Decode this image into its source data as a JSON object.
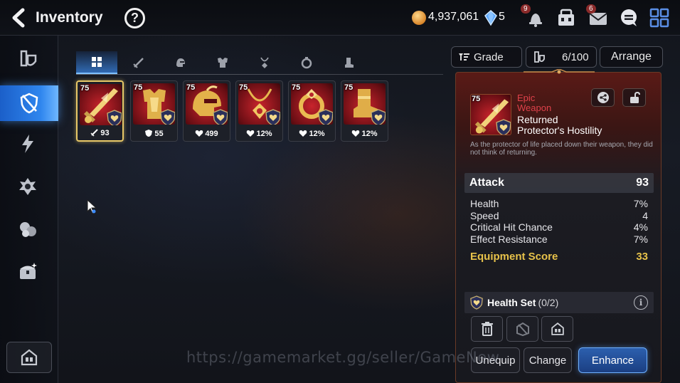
{
  "header": {
    "title": "Inventory",
    "help_label": "?",
    "gold": "4,937,061",
    "skystones": "5",
    "notif_badge_bell": "9",
    "notif_badge_mail": "6"
  },
  "sidebar": {
    "items": [
      {
        "name": "equipment-category-icon"
      },
      {
        "name": "gear-category-icon",
        "active": true
      },
      {
        "name": "lightning-category-icon"
      },
      {
        "name": "artifact-category-icon"
      },
      {
        "name": "material-category-icon"
      },
      {
        "name": "chest-category-icon"
      }
    ]
  },
  "filter_tabs": [
    "all",
    "weapon",
    "helmet",
    "armor",
    "necklace",
    "ring",
    "boots"
  ],
  "items": [
    {
      "level": "75",
      "stat": "93",
      "stat_icon": "attack-icon",
      "selected": true
    },
    {
      "level": "75",
      "stat": "55",
      "stat_icon": "defense-icon"
    },
    {
      "level": "75",
      "stat": "499",
      "stat_icon": "health-icon"
    },
    {
      "level": "75",
      "stat": "12%",
      "stat_icon": "health-icon"
    },
    {
      "level": "75",
      "stat": "12%",
      "stat_icon": "health-icon"
    },
    {
      "level": "75",
      "stat": "12%",
      "stat_icon": "health-icon"
    }
  ],
  "controls": {
    "grade_label": "Grade",
    "count_label": "6/100",
    "arrange_label": "Arrange"
  },
  "detail": {
    "level": "75",
    "rarity_line1": "Epic",
    "rarity_line2": "Weapon",
    "name_line1": "Returned",
    "name_line2": "Protector's Hostility",
    "description": "As the protector of life placed down their weapon, they did not think of returning.",
    "main_stat_label": "Attack",
    "main_stat_value": "93",
    "substats": [
      {
        "label": "Health",
        "value": "7%"
      },
      {
        "label": "Speed",
        "value": "4"
      },
      {
        "label": "Critical Hit Chance",
        "value": "4%"
      },
      {
        "label": "Effect Resistance",
        "value": "7%"
      }
    ],
    "score_label": "Equipment Score",
    "score_value": "33",
    "set_name": "Health Set",
    "set_count": "(0/2)",
    "info_label": "i",
    "unequip_label": "Unequip",
    "change_label": "Change",
    "enhance_label": "Enhance"
  },
  "watermark": "https://gamemarket.gg/seller/GameNew",
  "colors": {
    "accent_blue": "#2f86ee",
    "epic_red": "#e0414a",
    "score_gold": "#e7c24a",
    "selected_border": "#e7c767"
  }
}
